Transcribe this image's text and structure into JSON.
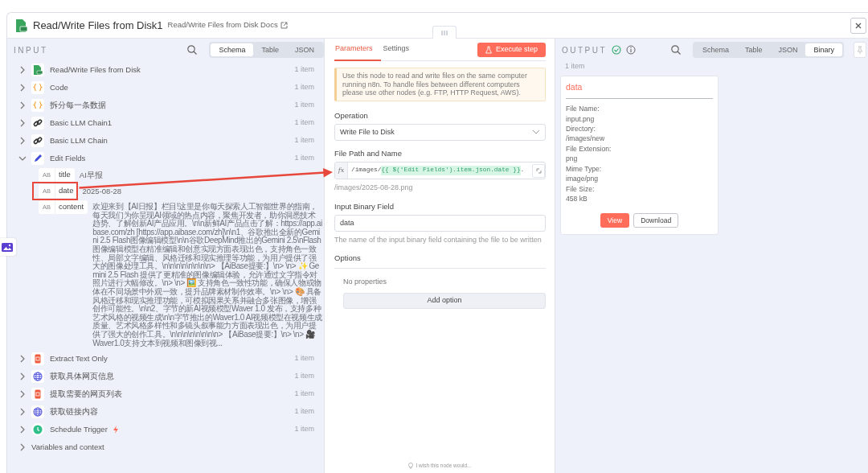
{
  "header": {
    "title": "Read/Write Files from Disk1",
    "docs_link": "Read/Write Files from Disk Docs"
  },
  "input": {
    "label": "INPUT",
    "views": [
      {
        "label": "Schema",
        "selected": true
      },
      {
        "label": "Table",
        "selected": false
      },
      {
        "label": "JSON",
        "selected": false
      }
    ],
    "nodes": [
      {
        "name": "Read/Write Files from Disk",
        "kind": "file",
        "count": "1 item",
        "expanded": false,
        "trigger": false
      },
      {
        "name": "Code",
        "kind": "braces",
        "count": "1 item",
        "expanded": false,
        "trigger": false
      },
      {
        "name": "拆分每一条数据",
        "kind": "braces",
        "count": "1 item",
        "expanded": false,
        "trigger": false
      },
      {
        "name": "Basic LLM Chain1",
        "kind": "link",
        "count": "1 item",
        "expanded": false,
        "trigger": false
      },
      {
        "name": "Basic LLM Chain",
        "kind": "link",
        "count": "1 item",
        "expanded": false,
        "trigger": false
      },
      {
        "name": "Edit Fields",
        "kind": "pencil",
        "count": "1 item",
        "expanded": true,
        "trigger": false,
        "fields": [
          {
            "type_tag": "AB",
            "name": "title",
            "value": "AI早报",
            "highlighted": false
          },
          {
            "type_tag": "AB",
            "name": "date",
            "value": "2025-08-28",
            "highlighted": true
          },
          {
            "type_tag": "AB",
            "name": "content",
            "value": "欢迎来到【AI日报】栏目!这里是你每天探索人工智能世界的指南，每天我们为你呈现AI领域的热点内容，聚焦开发者，助你洞悉技术趋势、了解创新AI产品应用。\\n\\n新鲜AI产品点击了解：https://app.aibase.com/zh [https://app.aibase.com/zh]\\n\\n1、谷歌推出全新的Gemini 2.5 Flash图像编辑模型\\n\\n谷歌DeepMind推出的Gemini 2.5\\nFlash图像编辑模型在精准编辑和创意实现方面表现出色，支持角色一致性、局部文字编辑、风格迁移和现实推理等功能，为用户提供了强大的图像处理工具。\\n\\n\\n\\n\\n\\n\\n\\n> 【AiBase提要:】\\n> \\n> ✨ Gemini 2.5 Flash 提供了更精准的图像编辑体验，允许通过文字指令对照片进行大幅修改。\\n> \\n> 🖼️ 支持角色一致性功能，确保人物或物体在不同场景中外观一致，提升品牌素材制作效率。\\n> \\n> 🎨 具备风格迁移和现实推理功能，可模拟因果关系并融合多张图像，增强创作可能性。\\n\\n2、字节的新AI视频模型Waver 1.0 发布，支持多种艺术风格的视频生成\\n\\n字节推出的Waver1.0 AI视频模型在视频生成质量、艺术风格多样性和多镜头叙事能力方面表现出色，为用户提供了强大的创作工具。\\n\\n\\n\\n\\n\\n\\n\\n> 【AiBase提要:】\\n> \\n> 🎥 Waver1.0支持文本到视频和图像到视...",
            "highlighted": false
          }
        ]
      },
      {
        "name": "Extract Text Only",
        "kind": "html",
        "count": "1 item",
        "expanded": false,
        "trigger": false
      },
      {
        "name": "获取具体网页信息",
        "kind": "globe",
        "count": "1 item",
        "expanded": false,
        "trigger": false
      },
      {
        "name": "提取需要的网页列表",
        "kind": "html",
        "count": "1 item",
        "expanded": false,
        "trigger": false
      },
      {
        "name": "获取链接内容",
        "kind": "globe",
        "count": "1 item",
        "expanded": false,
        "trigger": false
      },
      {
        "name": "Schedule Trigger",
        "kind": "clock",
        "count": "1 item",
        "expanded": false,
        "trigger": true
      }
    ],
    "variables": {
      "label": "Variables and context",
      "expanded": false
    }
  },
  "parameters": {
    "tabs": [
      {
        "label": "Parameters",
        "selected": true
      },
      {
        "label": "Settings",
        "selected": false
      }
    ],
    "execute_button": "Execute step",
    "notice": "Use this node to read and write files on the same computer running n8n. To handle files between different computers please use other nodes (e.g. FTP, HTTP Request, AWS).",
    "operation": {
      "label": "Operation",
      "value": "Write File to Disk"
    },
    "file_path": {
      "label": "File Path and Name",
      "fx": "fx",
      "prefix": "/images/",
      "expression": "{{ $('Edit Fields').item.json.date }}",
      "suffix": ".",
      "preview": "/images/2025-08-28.png"
    },
    "binary_field": {
      "label": "Input Binary Field",
      "value": "data",
      "hint": "The name of the input binary field containing the file to be written"
    },
    "options": {
      "label": "Options",
      "empty": "No properties",
      "add_button": "Add option"
    },
    "feedback": "I wish this node would..."
  },
  "output": {
    "label": "OUTPUT",
    "executed": true,
    "views": [
      {
        "label": "Schema",
        "selected": false
      },
      {
        "label": "Table",
        "selected": false
      },
      {
        "label": "JSON",
        "selected": false
      },
      {
        "label": "Binary",
        "selected": true
      }
    ],
    "count": "1 item",
    "binary": {
      "key": "data",
      "meta": [
        {
          "label": "File Name:",
          "value": "input.png"
        },
        {
          "label": "Directory:",
          "value": "/images/new"
        },
        {
          "label": "File Extension:",
          "value": "png"
        },
        {
          "label": "Mime Type:",
          "value": "image/png"
        },
        {
          "label": "File Size:",
          "value": "458 kB"
        }
      ],
      "view_button": "View",
      "download_button": "Download"
    }
  }
}
